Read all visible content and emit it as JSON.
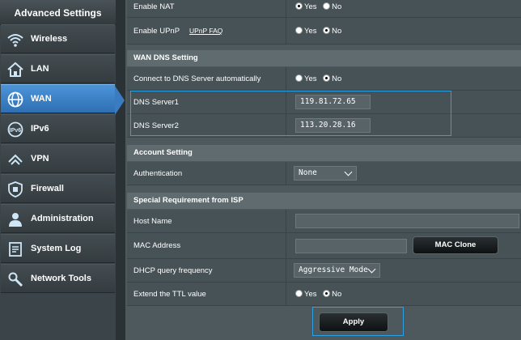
{
  "sidebar": {
    "title": "Advanced Settings",
    "items": [
      {
        "label": "Wireless",
        "icon": "wifi-icon"
      },
      {
        "label": "LAN",
        "icon": "home-icon"
      },
      {
        "label": "WAN",
        "icon": "globe-icon"
      },
      {
        "label": "IPv6",
        "icon": "ipv6-icon"
      },
      {
        "label": "VPN",
        "icon": "vpn-icon"
      },
      {
        "label": "Firewall",
        "icon": "shield-icon"
      },
      {
        "label": "Administration",
        "icon": "user-icon"
      },
      {
        "label": "System Log",
        "icon": "log-icon"
      },
      {
        "label": "Network Tools",
        "icon": "tools-icon"
      }
    ],
    "active": "WAN"
  },
  "wan_top": {
    "enable_nat": {
      "label": "Enable NAT",
      "yes": "Yes",
      "no": "No",
      "selected": "Yes"
    },
    "enable_upnp": {
      "label": "Enable UPnP",
      "link": "UPnP  FAQ",
      "yes": "Yes",
      "no": "No",
      "selected": "No"
    }
  },
  "dns": {
    "header": "WAN DNS Setting",
    "auto": {
      "label": "Connect to DNS Server automatically",
      "yes": "Yes",
      "no": "No",
      "selected": "No"
    },
    "server1": {
      "label": "DNS Server1",
      "value": "119.81.72.65"
    },
    "server2": {
      "label": "DNS Server2",
      "value": "113.20.28.16"
    }
  },
  "account": {
    "header": "Account Setting",
    "auth": {
      "label": "Authentication",
      "value": "None"
    }
  },
  "isp": {
    "header": "Special Requirement from ISP",
    "host_name": {
      "label": "Host Name",
      "value": ""
    },
    "mac": {
      "label": "MAC Address",
      "value": "",
      "clone_label": "MAC Clone"
    },
    "dhcp": {
      "label": "DHCP query frequency",
      "value": "Aggressive Mode"
    },
    "ttl": {
      "label": "Extend the TTL value",
      "yes": "Yes",
      "no": "No",
      "selected": "No"
    }
  },
  "apply_label": "Apply",
  "colors": {
    "accent": "#2aa0e6",
    "active_nav": "#3a7cc1"
  }
}
